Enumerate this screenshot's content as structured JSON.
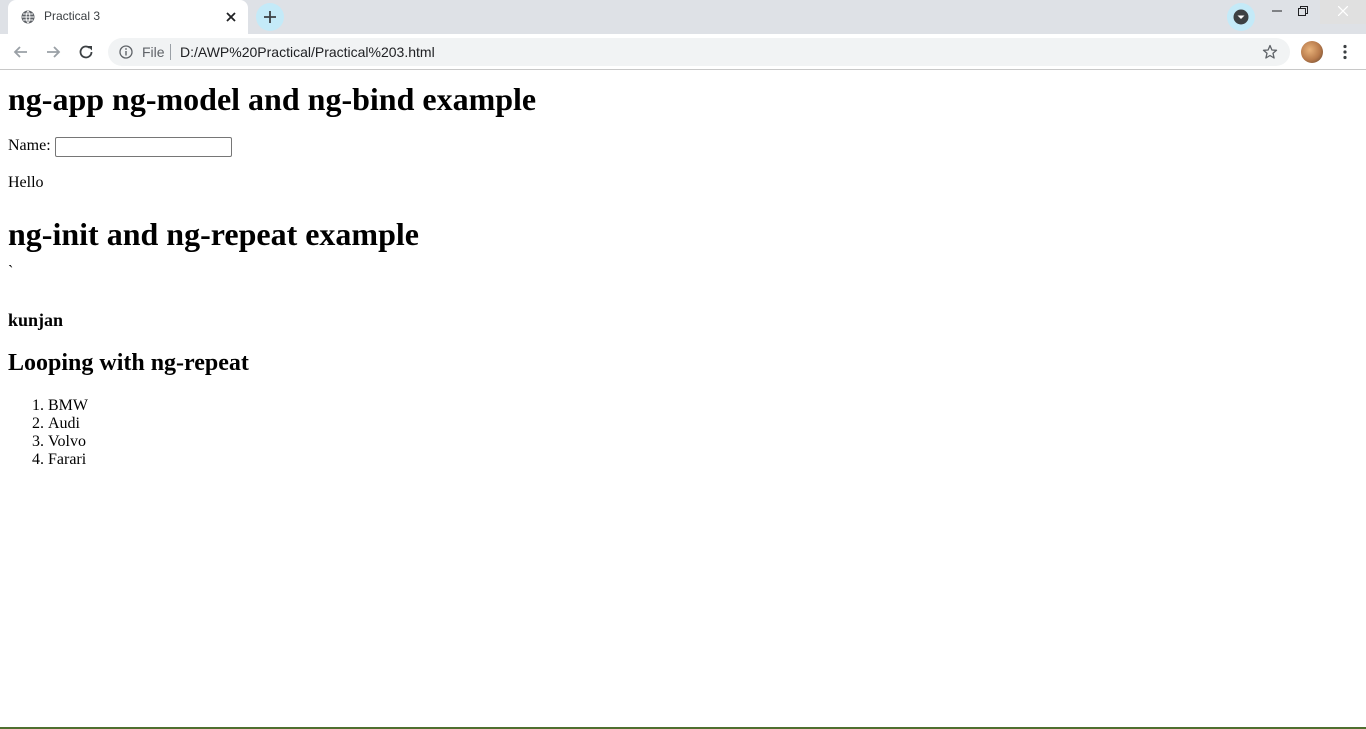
{
  "browser": {
    "tab": {
      "title": "Practical 3"
    },
    "omnibox": {
      "scheme_label": "File",
      "url": "D:/AWP%20Practical/Practical%203.html"
    },
    "icons": {
      "tab_favicon": "globe-icon",
      "tab_close": "close-icon",
      "new_tab": "plus-icon",
      "extension": "chevron-down-circle-icon",
      "back": "arrow-left-icon",
      "forward": "arrow-right-icon",
      "reload": "reload-icon",
      "info": "info-icon",
      "bookmark": "star-icon",
      "menu": "more-vert-icon"
    },
    "colors": {
      "accent": "#c4eaf8",
      "tabstrip": "#dee1e6"
    }
  },
  "page": {
    "heading1": "ng-app ng-model and ng-bind example",
    "name_label": "Name:",
    "name_value": "",
    "greeting": "Hello",
    "heading2": "ng-init and ng-repeat example",
    "stray_text": "`",
    "bold_name": "kunjan",
    "heading3": "Looping with ng-repeat",
    "cars": [
      "BMW",
      "Audi",
      "Volvo",
      "Farari"
    ]
  }
}
